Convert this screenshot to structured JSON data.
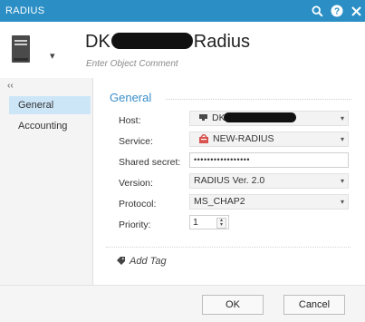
{
  "window": {
    "title": "RADIUS"
  },
  "header": {
    "name_prefix": "DK",
    "name_suffix": "Radius",
    "comment_placeholder": "Enter Object Comment"
  },
  "nav": {
    "collapse_glyph": "‹‹",
    "items": [
      {
        "label": "General"
      },
      {
        "label": "Accounting"
      }
    ]
  },
  "general": {
    "section_title": "General",
    "host": {
      "label": "Host:",
      "value": "DK"
    },
    "service": {
      "label": "Service:",
      "value": "NEW-RADIUS"
    },
    "shared_secret": {
      "label": "Shared secret:",
      "value": "•••••••••••••••••"
    },
    "version": {
      "label": "Version:",
      "value": "RADIUS Ver. 2.0"
    },
    "protocol": {
      "label": "Protocol:",
      "value": "MS_CHAP2"
    },
    "priority": {
      "label": "Priority:",
      "value": "1"
    }
  },
  "tags": {
    "add_label": "Add Tag"
  },
  "footer": {
    "ok_label": "OK",
    "cancel_label": "Cancel"
  },
  "icons": {
    "search": "search-icon",
    "help": "help-icon",
    "close": "close-icon",
    "object": "server-icon",
    "host": "server-icon",
    "service": "service-icon",
    "tag": "tag-icon"
  },
  "colors": {
    "accent": "#2b8fc5",
    "section": "#3a8fcb",
    "nav_active": "#cde6f7"
  }
}
